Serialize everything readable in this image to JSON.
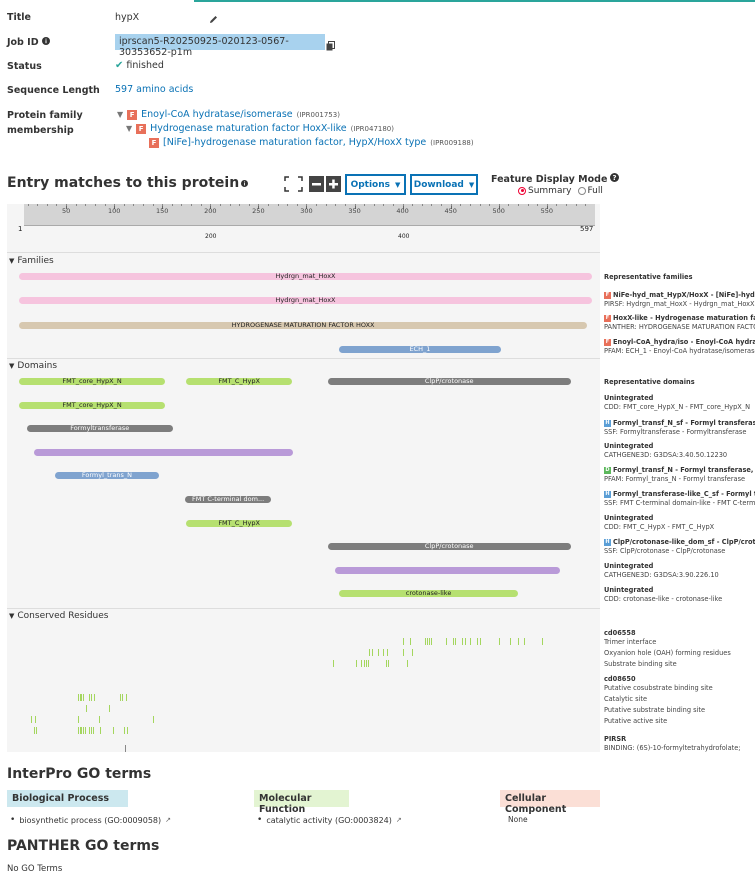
{
  "summary": {
    "title_label": "Title",
    "title_value": "hypX",
    "jobid_label": "Job ID",
    "jobid_value": "iprscan5-R20250925-020123-0567-30353652-p1m",
    "status_label": "Status",
    "status_value": "finished",
    "seqlen_label": "Sequence Length",
    "seqlen_value": "597 amino acids",
    "family_label_1": "Protein family",
    "family_label_2": "membership",
    "families": [
      {
        "name": "Enoyl-CoA hydratase/isomerase",
        "acc": "(IPR001753)",
        "badge": "F"
      },
      {
        "name": "Hydrogenase maturation factor HoxX-like",
        "acc": "(IPR047180)",
        "badge": "F"
      },
      {
        "name": "[NiFe]-hydrogenase maturation factor, HypX/HoxX type",
        "acc": "(IPR009188)",
        "badge": "F"
      }
    ]
  },
  "entry": {
    "heading": "Entry matches to this protein",
    "options_label": "Options",
    "download_label": "Download",
    "fdm_label": "Feature Display Mode",
    "summary_label": "Summary",
    "full_label": "Full",
    "selected_mode": "Summary"
  },
  "ruler": {
    "start": "1",
    "end": "597",
    "ticks": [
      "50",
      "100",
      "150",
      "200",
      "250",
      "300",
      "350",
      "400",
      "450",
      "500",
      "550"
    ],
    "lower_ticks": [
      "200",
      "400"
    ]
  },
  "sections": {
    "families": "Families",
    "domains": "Domains",
    "residues": "Conserved Residues"
  },
  "family_tracks": [
    {
      "label": "Hydrgn_mat_HoxX",
      "start": 1,
      "end": 597,
      "color": "#f6c4de"
    },
    {
      "label": "Hydrgn_mat_HoxX",
      "start": 1,
      "end": 597,
      "color": "#f6c4de"
    },
    {
      "label": "HYDROGENASE MATURATION FACTOR HOXX",
      "start": 1,
      "end": 592,
      "color": "#d7c8b0"
    },
    {
      "label": "ECH_1",
      "start": 334,
      "end": 502,
      "color": "#7fa3cf"
    }
  ],
  "domain_tracks": [
    {
      "row": 0,
      "label": "FMT_core_HypX_N",
      "start": 1,
      "end": 153,
      "color": "#b6e070"
    },
    {
      "row": 0,
      "label": "FMT_C_HypX",
      "start": 175,
      "end": 285,
      "color": "#b6e070"
    },
    {
      "row": 0,
      "label": "ClpP/crotonase",
      "start": 322,
      "end": 575,
      "color": "#7d7d7d"
    },
    {
      "row": 1,
      "label": "FMT_core_HypX_N",
      "start": 1,
      "end": 153,
      "color": "#b6e070"
    },
    {
      "row": 2,
      "label": "Formyltransferase",
      "start": 9,
      "end": 161,
      "color": "#7d7d7d"
    },
    {
      "row": 3,
      "label": "",
      "start": 17,
      "end": 286,
      "color": "#b99ad8"
    },
    {
      "row": 4,
      "label": "Formyl_trans_N",
      "start": 38,
      "end": 147,
      "color": "#7fa3cf"
    },
    {
      "row": 5,
      "label": "FMT C-terminal dom...",
      "start": 174,
      "end": 263,
      "color": "#7d7d7d"
    },
    {
      "row": 6,
      "label": "FMT_C_HypX",
      "start": 175,
      "end": 285,
      "color": "#b6e070"
    },
    {
      "row": 7,
      "label": "ClpP/crotonase",
      "start": 322,
      "end": 575,
      "color": "#7d7d7d"
    },
    {
      "row": 8,
      "label": "",
      "start": 330,
      "end": 564,
      "color": "#b99ad8"
    },
    {
      "row": 9,
      "label": "crotonase-like",
      "start": 334,
      "end": 520,
      "color": "#b6e070"
    }
  ],
  "residue_rows": [
    {
      "row": 0,
      "positions": [
        400,
        408,
        423,
        425,
        427,
        430,
        445,
        452,
        455,
        462,
        465,
        470,
        477,
        480,
        500,
        512,
        520,
        526,
        545
      ]
    },
    {
      "row": 1,
      "positions": [
        365,
        368,
        374,
        380,
        384,
        400,
        410
      ]
    },
    {
      "row": 2,
      "positions": [
        328,
        352,
        357,
        360,
        362,
        364,
        383,
        385,
        405
      ]
    },
    {
      "row": 4,
      "positions": [
        62,
        64,
        66,
        68,
        74,
        76,
        79,
        106,
        108,
        112
      ]
    },
    {
      "row": 5,
      "positions": [
        71,
        95
      ]
    },
    {
      "row": 6,
      "positions": [
        13,
        18,
        62,
        84,
        140
      ]
    },
    {
      "row": 7,
      "positions": [
        17,
        19,
        62,
        64,
        66,
        68,
        70,
        74,
        76,
        78,
        85,
        99,
        110,
        113
      ]
    },
    {
      "row": 9,
      "positions": [
        111
      ],
      "gray": true
    }
  ],
  "sidebar": {
    "rep_families": "Representative families",
    "fam_items": [
      {
        "title": "NiFe-hyd_mat_HypX/HoxX - [NiFe]-hydrog",
        "sub": "PIRSF: Hydrgn_mat_HoxX - Hydrgn_mat_HoxX"
      },
      {
        "title": "HoxX-like - Hydrogenase maturation factor",
        "sub": "PANTHER: HYDROGENASE MATURATION FACTOR"
      },
      {
        "title": "Enoyl-CoA_hydra/iso - Enoyl-CoA hydratas",
        "sub": "PFAM: ECH_1 - Enoyl-CoA hydratase/isomerase"
      }
    ],
    "rep_domains": "Representative domains",
    "dom_items": [
      {
        "title": "Unintegrated",
        "sub": "CDD: FMT_core_HypX_N - FMT_core_HypX_N",
        "badge": ""
      },
      {
        "title": "Formyl_transf_N_sf - Formyl transferase,",
        "sub": "SSF: Formyltransferase - Formyltransferase",
        "badge": "H"
      },
      {
        "title": "Unintegrated",
        "sub": "CATHGENE3D: G3DSA:3.40.50.12230",
        "badge": ""
      },
      {
        "title": "Formyl_transf_N - Formyl transferase, N",
        "sub": "PFAM: Formyl_trans_N - Formyl transferase",
        "badge": "D"
      },
      {
        "title": "Formyl_transferase-like_C_sf - Formyl tra",
        "sub": "SSF: FMT C-terminal domain-like - FMT C-term",
        "badge": "H"
      },
      {
        "title": "Unintegrated",
        "sub": "CDD: FMT_C_HypX - FMT_C_HypX",
        "badge": ""
      },
      {
        "title": "ClpP/crotonase-like_dom_sf - ClpP/croton",
        "sub": "SSF: ClpP/crotonase - ClpP/crotonase",
        "badge": "H"
      },
      {
        "title": "Unintegrated",
        "sub": "CATHGENE3D: G3DSA:3.90.226.10",
        "badge": ""
      },
      {
        "title": "Unintegrated",
        "sub": "CDD: crotonase-like - crotonase-like",
        "badge": ""
      }
    ],
    "res_groups": [
      {
        "title": "cd06558",
        "items": [
          "Trimer interface",
          "Oxyanion hole (OAH) forming residues",
          "Substrate binding site"
        ]
      },
      {
        "title": "cd08650",
        "items": [
          "Putative cosubstrate binding site",
          "Catalytic site",
          "Putative substrate binding site",
          "Putative active site"
        ]
      },
      {
        "title": "PIRSR",
        "items": [
          "BINDING: (6S)-10-formyltetrahydrofolate;"
        ]
      }
    ]
  },
  "go": {
    "heading": "InterPro GO terms",
    "bp_label": "Biological Process",
    "mf_label": "Molecular Function",
    "cc_label": "Cellular Component",
    "bp_item": "biosynthetic process (GO:0009058)",
    "mf_item": "catalytic activity (GO:0003824)",
    "cc_item": "None",
    "colors": {
      "bp": "#cce8ef",
      "mf": "#e3f4d2",
      "cc": "#fbdfd6"
    }
  },
  "panther": {
    "heading": "PANTHER GO terms",
    "none_text": "No GO Terms"
  }
}
